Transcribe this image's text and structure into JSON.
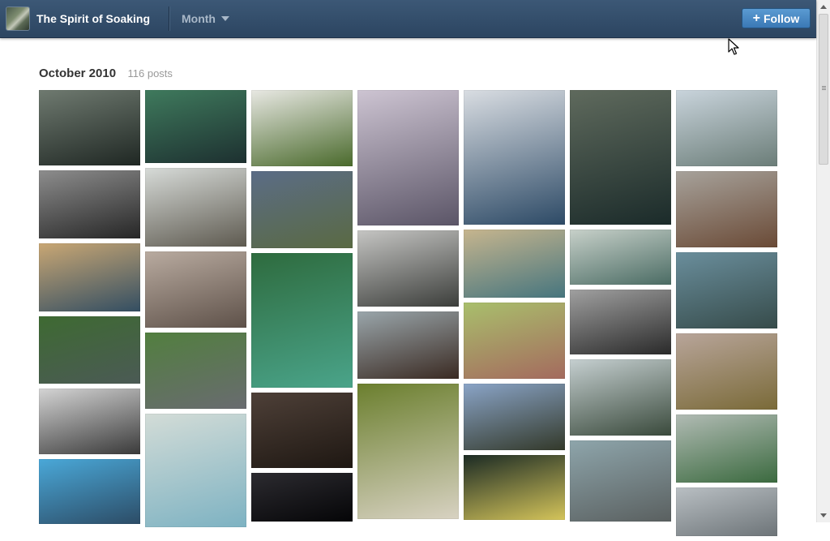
{
  "blog": {
    "title": "The Spirit of Soaking"
  },
  "nav": {
    "month_label": "Month"
  },
  "follow": {
    "label": "Follow"
  },
  "archive": {
    "month": "October 2010",
    "post_count": "116 posts"
  },
  "icons": {
    "avatar": "blog-avatar",
    "plus": "plus-icon",
    "dropdown": "chevron-down-icon",
    "cursor": "mouse-cursor"
  },
  "columns": [
    [
      {
        "subject": "bathers in steaming pool",
        "h": 93,
        "c1": "#6f7a70",
        "c2": "#1f2723"
      },
      {
        "subject": "black and white soak",
        "h": 84,
        "c1": "#8d8d8d",
        "c2": "#262626"
      },
      {
        "subject": "desert pool",
        "h": 84,
        "c1": "#c9a774",
        "c2": "#334e62"
      },
      {
        "subject": "river bathers",
        "h": 83,
        "c1": "#3e6a32",
        "c2": "#4b5a55"
      },
      {
        "subject": "crowded bath bw",
        "h": 81,
        "c1": "#d4d4d4",
        "c2": "#3a3a3a"
      },
      {
        "subject": "indoor pool",
        "h": 80,
        "c1": "#4aa8d8",
        "c2": "#2c4c66"
      }
    ],
    [
      {
        "subject": "waterfall cave pool",
        "h": 90,
        "c1": "#3f7a5d",
        "c2": "#1d3030"
      },
      {
        "subject": "seaside rock pool",
        "h": 97,
        "c1": "#d7dbd8",
        "c2": "#5e5a50"
      },
      {
        "subject": "rocky canyon",
        "h": 94,
        "c1": "#b9aba0",
        "c2": "#5e5149"
      },
      {
        "subject": "bathers in green pool",
        "h": 94,
        "c1": "#527f3f",
        "c2": "#696b70"
      },
      {
        "subject": "white terraces",
        "h": 140,
        "c1": "#d3dcd7",
        "c2": "#7db2c2"
      }
    ],
    [
      {
        "subject": "stone ring pool",
        "h": 94,
        "c1": "#e8e8e3",
        "c2": "#4a6a2c"
      },
      {
        "subject": "creek soakers",
        "h": 95,
        "c1": "#5b6c86",
        "c2": "#5a6a43"
      },
      {
        "subject": "waterfall emerald pool",
        "h": 166,
        "c1": "#2e6b3e",
        "c2": "#4aa48a"
      },
      {
        "subject": "cave bathers",
        "h": 93,
        "c1": "#4e4038",
        "c2": "#1e1712"
      },
      {
        "subject": "night",
        "h": 60,
        "c1": "#2c2b30",
        "c2": "#050507"
      }
    ],
    [
      {
        "subject": "two women in hijab",
        "h": 167,
        "c1": "#cdc4d2",
        "c2": "#5b5567"
      },
      {
        "subject": "forest hot spring",
        "h": 94,
        "c1": "#c5c5c3",
        "c2": "#3c3e3b"
      },
      {
        "subject": "crowd in steaming pool",
        "h": 83,
        "c1": "#9aa6ab",
        "c2": "#3a2a22"
      },
      {
        "subject": "waterfall terraces",
        "h": 167,
        "c1": "#6b7f2e",
        "c2": "#d8d2c2"
      }
    ],
    [
      {
        "subject": "snowy river soak",
        "h": 166,
        "c1": "#d9dde2",
        "c2": "#2d4a66"
      },
      {
        "subject": "mountain pool",
        "h": 84,
        "c1": "#c6b58e",
        "c2": "#46757e"
      },
      {
        "subject": "couple in pink hat",
        "h": 94,
        "c1": "#a9bf6c",
        "c2": "#a46a5e"
      },
      {
        "subject": "valley lake",
        "h": 82,
        "c1": "#8aa4c7",
        "c2": "#33392a"
      },
      {
        "subject": "night pool with lights",
        "h": 80,
        "c1": "#1b2a24",
        "c2": "#d4c45a"
      }
    ],
    [
      {
        "subject": "waterfall bather",
        "h": 166,
        "c1": "#5f6a5d",
        "c2": "#1b2b2a"
      },
      {
        "subject": "men in river",
        "h": 68,
        "c1": "#c7d0c9",
        "c2": "#4b6c64"
      },
      {
        "subject": "woman portrait bw",
        "h": 80,
        "c1": "#a0a0a0",
        "c2": "#2a2a2a"
      },
      {
        "subject": "foggy forest river",
        "h": 94,
        "c1": "#c5cfd0",
        "c2": "#3a4a3c"
      },
      {
        "subject": "smiling woman in pool",
        "h": 100,
        "c1": "#8ea5ab",
        "c2": "#5a6060"
      }
    ],
    [
      {
        "subject": "terraced bath",
        "h": 94,
        "c1": "#c9d4dc",
        "c2": "#6b7d78"
      },
      {
        "subject": "wooden tub steam",
        "h": 94,
        "c1": "#a7a29b",
        "c2": "#6a4a36"
      },
      {
        "subject": "crowded pool",
        "h": 94,
        "c1": "#6a8e9c",
        "c2": "#364b4a"
      },
      {
        "subject": "rock bath crowd",
        "h": 94,
        "c1": "#b8a59a",
        "c2": "#7a6a38"
      },
      {
        "subject": "misty forest pool",
        "h": 84,
        "c1": "#b1bbb4",
        "c2": "#3b6a3f"
      },
      {
        "subject": "river",
        "h": 60,
        "c1": "#b9bfc3",
        "c2": "#6d7478"
      }
    ]
  ]
}
